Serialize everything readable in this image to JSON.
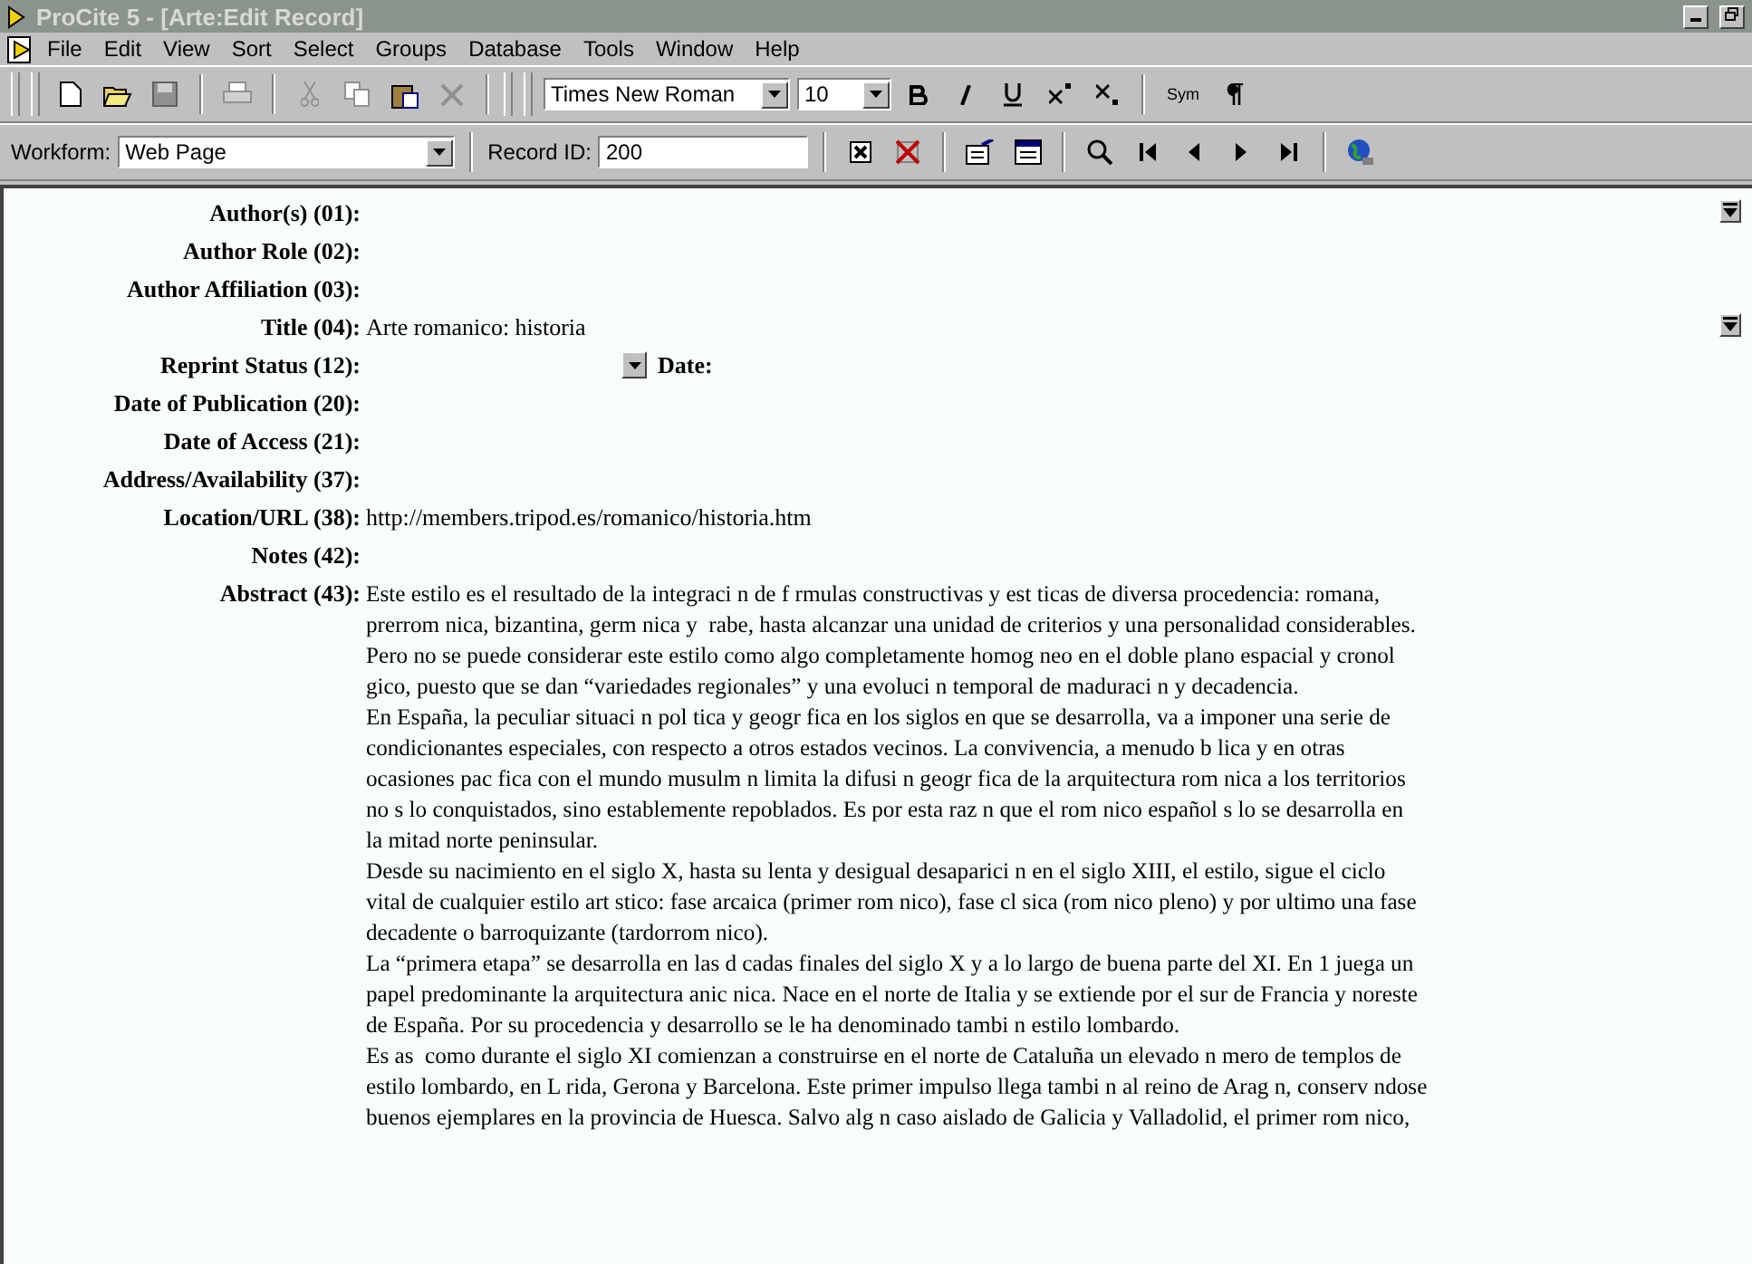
{
  "window": {
    "title": "ProCite 5 - [Arte:Edit Record]"
  },
  "menu": [
    "File",
    "Edit",
    "View",
    "Sort",
    "Select",
    "Groups",
    "Database",
    "Tools",
    "Window",
    "Help"
  ],
  "format_toolbar": {
    "font": "Times New Roman",
    "size": "10",
    "sym": "Sym"
  },
  "record_bar": {
    "workform_label": "Workform:",
    "workform": "Web Page",
    "record_id_label": "Record ID:",
    "record_id": "200"
  },
  "fields": [
    {
      "label": "Author(s) (01):",
      "expand": true
    },
    {
      "label": "Author Role (02):",
      "expand": false
    },
    {
      "label": "Author Affiliation (03):",
      "expand": false
    },
    {
      "label": "Title (04):",
      "value": "Arte romanico: historia",
      "expand": true
    },
    {
      "label": "Reprint Status (12):",
      "expand": false,
      "date_label": "Date:"
    },
    {
      "label": "Date of Publication (20):",
      "expand": false
    },
    {
      "label": "Date of Access (21):",
      "expand": false
    },
    {
      "label": "Address/Availability (37):",
      "expand": false
    },
    {
      "label": "Location/URL (38):",
      "value": "http://members.tripod.es/romanico/historia.htm",
      "expand": false
    },
    {
      "label": "Notes (42):",
      "expand": false
    }
  ],
  "abstract": {
    "label": "Abstract (43):",
    "lines": [
      "Este estilo es el resultado de la integraci n de f rmulas constructivas y est ticas de diversa procedencia: romana,",
      "prerrom nica, bizantina, germ nica y  rabe, hasta alcanzar una unidad de criterios y una personalidad considerables.",
      "Pero no se puede considerar este estilo como algo completamente homog neo en el doble plano espacial y cronol",
      "gico, puesto que se dan “variedades regionales” y una evoluci n temporal de maduraci n y decadencia.",
      "En España, la peculiar situaci n pol tica y geogr fica en los siglos en que se desarrolla, va a imponer una serie de",
      "condicionantes especiales, con respecto a otros estados vecinos. La convivencia, a menudo b lica y en otras",
      "ocasiones pac fica con el mundo musulm n limita la difusi n geogr fica de la arquitectura rom nica a los territorios",
      "no s lo conquistados, sino establemente repoblados. Es por esta raz n que el rom nico español s lo se desarrolla en",
      "la mitad norte peninsular.",
      "Desde su nacimiento en el siglo X, hasta su lenta y desigual desaparici n en el siglo XIII, el estilo, sigue el ciclo",
      "vital de cualquier estilo art stico: fase arcaica (primer rom nico), fase cl sica (rom nico pleno) y por ultimo una fase",
      "decadente o barroquizante (tardorrom nico).",
      "La “primera etapa” se desarrolla en las d cadas finales del siglo X y a lo largo de buena parte del XI. En 1 juega un",
      "papel predominante la arquitectura anic nica. Nace en el norte de Italia y se extiende por el sur de Francia y noreste",
      "de España. Por su procedencia y desarrollo se le ha denominado tambi n estilo lombardo.",
      "Es as  como durante el siglo XI comienzan a construirse en el norte de Cataluña un elevado n mero de templos de",
      "estilo lombardo, en L rida, Gerona y Barcelona. Este primer impulso llega tambi n al reino de Arag n, conserv ndose",
      "buenos ejemplares en la provincia de Huesca. Salvo alg n caso aislado de Galicia y Valladolid, el primer rom nico,"
    ]
  }
}
